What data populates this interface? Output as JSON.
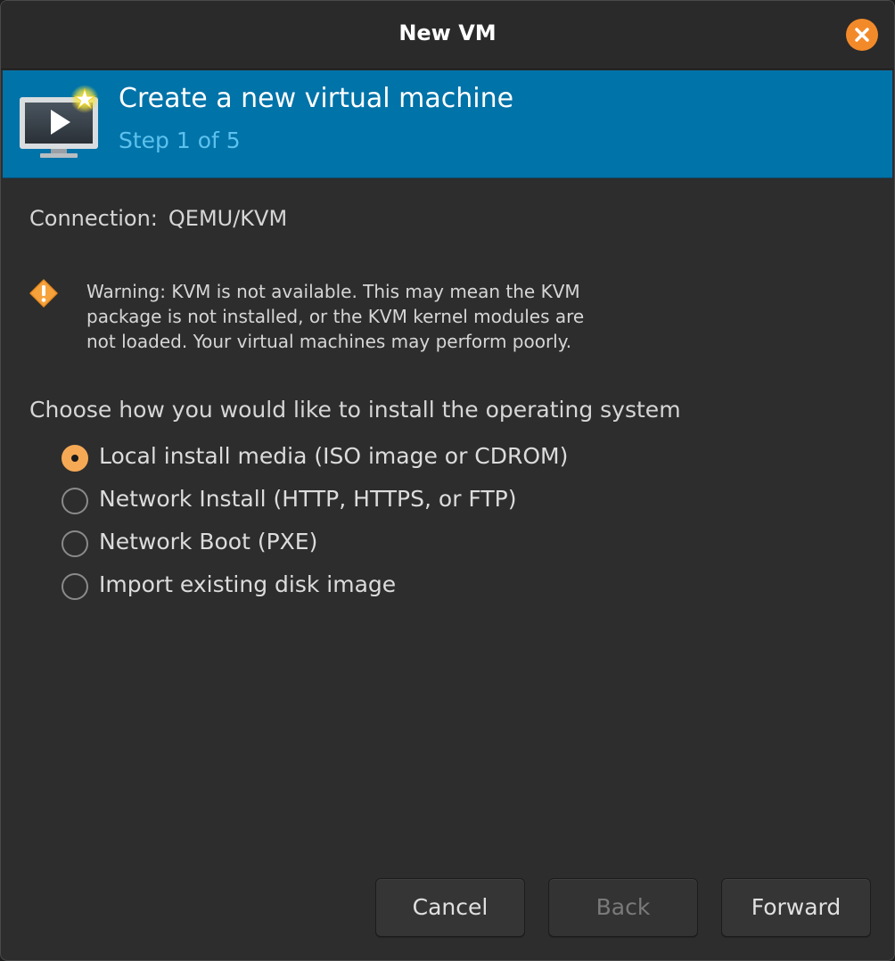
{
  "window": {
    "title": "New VM"
  },
  "header": {
    "title": "Create a new virtual machine",
    "step": "Step 1 of 5"
  },
  "connection": {
    "label": "Connection:",
    "value": "QEMU/KVM"
  },
  "warning": {
    "line1": "Warning: KVM is not available. This may mean the KVM",
    "line2": "package is not installed, or the KVM kernel modules are",
    "line3": "not loaded. Your virtual machines may perform poorly."
  },
  "install": {
    "prompt": "Choose how you would like to install the operating system",
    "options": [
      {
        "label": "Local install media (ISO image or CDROM)",
        "selected": true
      },
      {
        "label": "Network Install (HTTP, HTTPS, or FTP)",
        "selected": false
      },
      {
        "label": "Network Boot (PXE)",
        "selected": false
      },
      {
        "label": "Import existing disk image",
        "selected": false
      }
    ]
  },
  "buttons": {
    "cancel": "Cancel",
    "back": "Back",
    "forward": "Forward"
  },
  "colors": {
    "banner": "#0073a8",
    "step_text": "#5cc1ee",
    "accent_orange": "#f38a2a",
    "radio_selected": "#f6a955"
  },
  "icons": {
    "close": "close-icon",
    "banner": "new-vm-monitor-icon",
    "warning": "warning-icon"
  }
}
